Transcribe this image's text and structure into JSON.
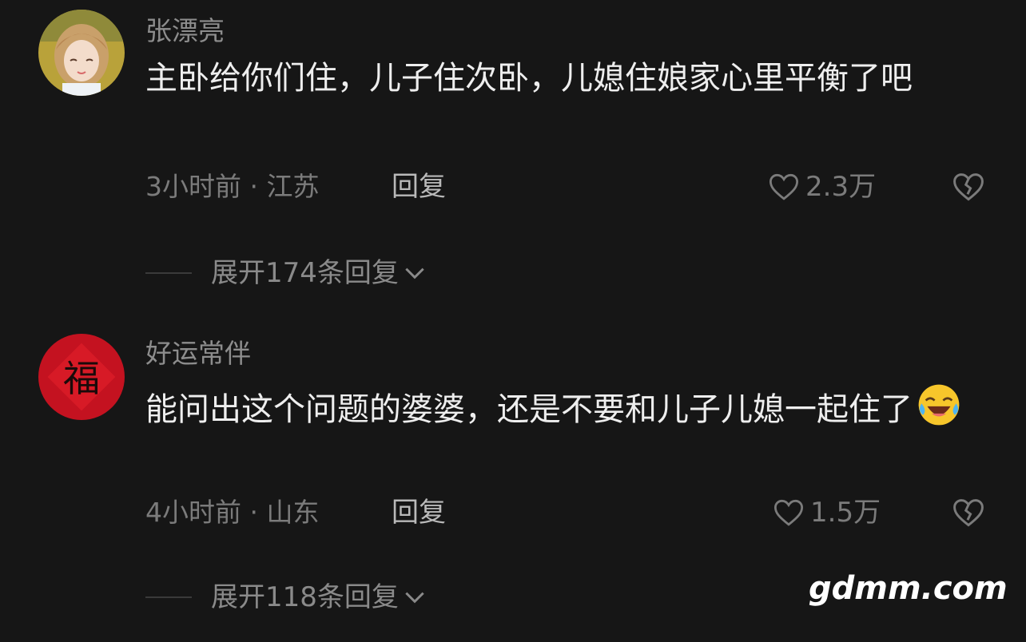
{
  "comments": [
    {
      "username": "张漂亮",
      "avatar_icon": "girl-portrait-avatar",
      "text": "主卧给你们住，儿子住次卧，儿媳住娘家心里平衡了吧",
      "meta": "3小时前 · 江苏",
      "reply_label": "回复",
      "likes": "2.3万",
      "expand_label": "展开174条回复"
    },
    {
      "username": "好运常伴",
      "avatar_icon": "fu-character-avatar",
      "avatar_char": "福",
      "text": "能问出这个问题的婆婆，还是不要和儿子儿媳一起住了",
      "emoji": "laughing-crying-emoji",
      "meta": "4小时前 · 山东",
      "reply_label": "回复",
      "likes": "1.5万",
      "expand_label": "展开118条回复"
    }
  ],
  "watermark": "gdmm.com",
  "colors": {
    "background": "#161616",
    "text_primary": "#eeeeee",
    "text_secondary": "#8d8d8d",
    "avatar_red": "#c41220"
  }
}
